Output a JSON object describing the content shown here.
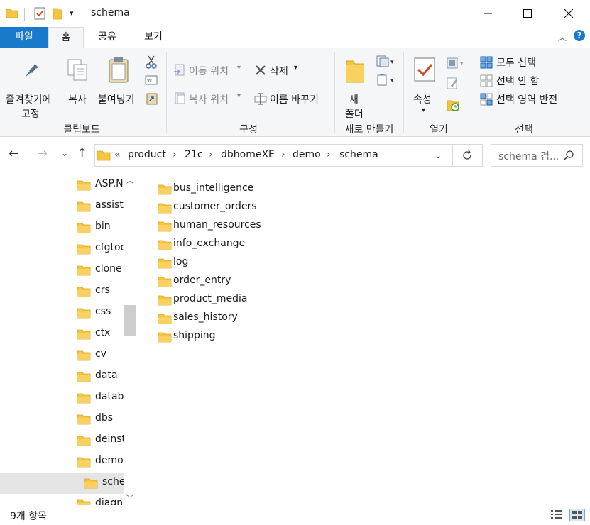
{
  "window": {
    "title": "schema",
    "minimize_glyph": "—",
    "maximize_glyph": "☐",
    "close_glyph": "✕"
  },
  "tabs": {
    "file": "파일",
    "home": "홈",
    "share": "공유",
    "view": "보기"
  },
  "ribbon": {
    "clipboard": {
      "pin_label_1": "즐겨찾기에",
      "pin_label_2": "고정",
      "copy": "복사",
      "paste": "붙여넣기",
      "group": "클립보드"
    },
    "organize": {
      "move_to": "이동 위치",
      "copy_to": "복사 위치",
      "delete": "삭제",
      "rename": "이름 바꾸기",
      "group": "구성"
    },
    "new": {
      "new_folder_1": "새",
      "new_folder_2": "폴더",
      "group": "새로 만들기"
    },
    "open": {
      "properties": "속성",
      "group": "열기"
    },
    "select": {
      "select_all": "모두 선택",
      "select_none": "선택 안 함",
      "invert": "선택 영역 반전",
      "group": "선택"
    }
  },
  "address": {
    "overflow": "«",
    "crumbs": [
      "product",
      "21c",
      "dbhomeXE",
      "demo",
      "schema"
    ],
    "search_placeholder": "schema 검..."
  },
  "nav_tree": [
    {
      "label": "ASP.NET",
      "selected": false
    },
    {
      "label": "assistants",
      "selected": false
    },
    {
      "label": "bin",
      "selected": false
    },
    {
      "label": "cfgtoollogs",
      "selected": false
    },
    {
      "label": "clone",
      "selected": false
    },
    {
      "label": "crs",
      "selected": false
    },
    {
      "label": "css",
      "selected": false
    },
    {
      "label": "ctx",
      "selected": false
    },
    {
      "label": "cv",
      "selected": false
    },
    {
      "label": "data",
      "selected": false
    },
    {
      "label": "database",
      "selected": false
    },
    {
      "label": "dbs",
      "selected": false
    },
    {
      "label": "deinstall",
      "selected": false
    },
    {
      "label": "demo",
      "selected": false
    },
    {
      "label": "schema",
      "selected": true
    },
    {
      "label": "diagnostics",
      "selected": false
    }
  ],
  "files": [
    "bus_intelligence",
    "customer_orders",
    "human_resources",
    "info_exchange",
    "log",
    "order_entry",
    "product_media",
    "sales_history",
    "shipping"
  ],
  "status": {
    "count_text": "9개 항목"
  },
  "colors": {
    "folder": "#f5c542",
    "accent": "#1979ca",
    "selection": "#e5e5e5"
  }
}
